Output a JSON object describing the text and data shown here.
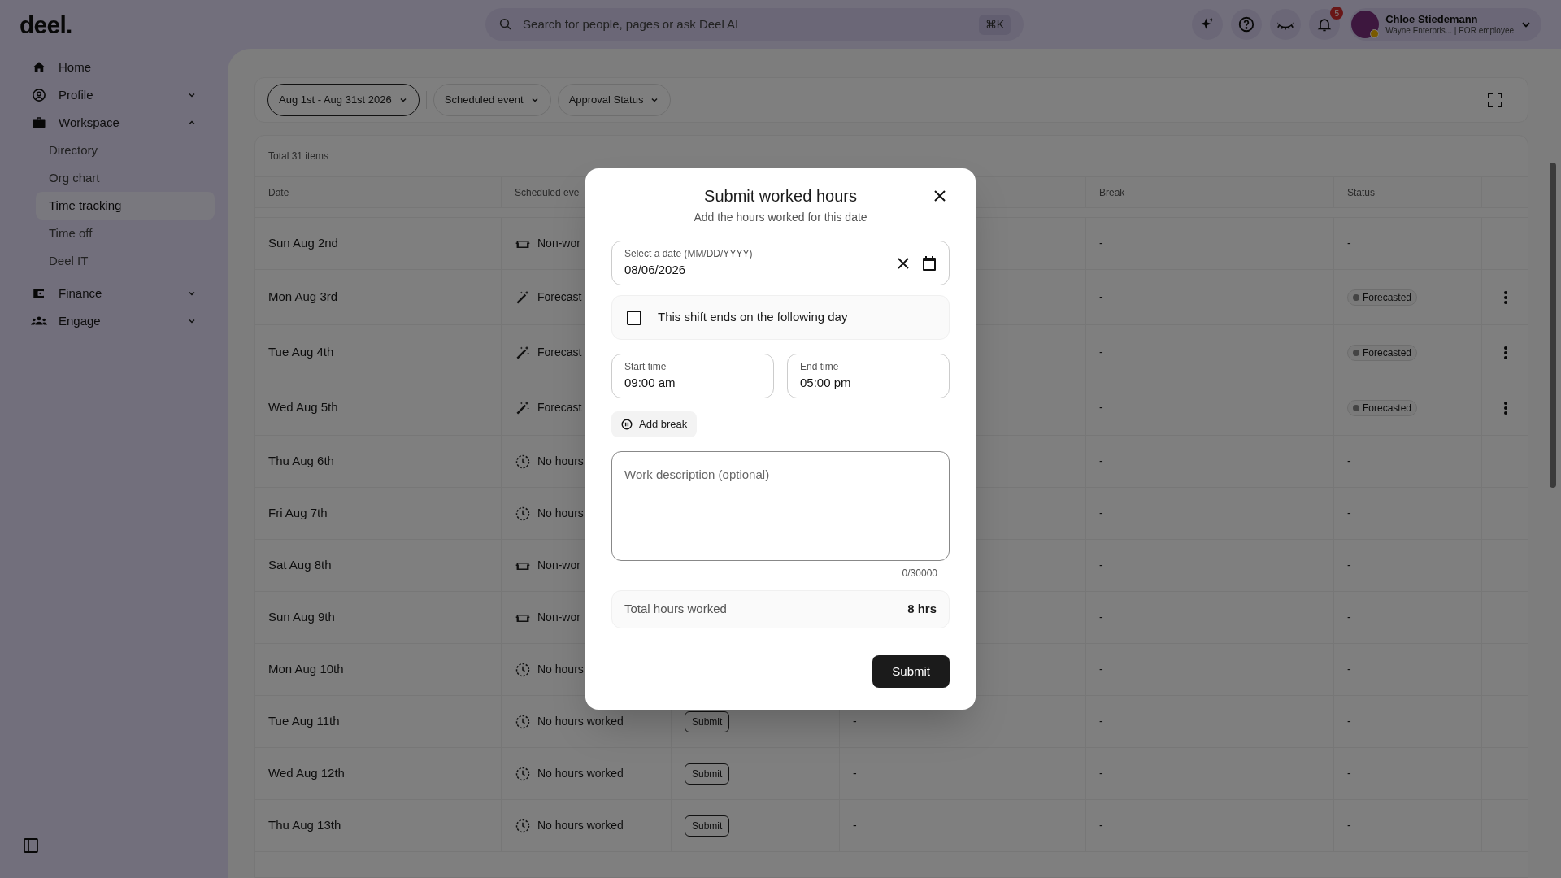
{
  "topbar": {
    "logo": "deel.",
    "search": {
      "placeholder": "Search for people, pages or ask Deel AI",
      "shortcut": "⌘K"
    },
    "notifications": "5",
    "user": {
      "name": "Chloe Stiedemann",
      "subtitle": "Wayne Enterpris... | EOR employee"
    }
  },
  "sidebar": {
    "items": [
      {
        "label": "Home"
      },
      {
        "label": "Profile",
        "expanded": false
      },
      {
        "label": "Workspace",
        "expanded": true,
        "children": [
          {
            "label": "Directory",
            "selected": false
          },
          {
            "label": "Org chart",
            "selected": false
          },
          {
            "label": "Time tracking",
            "selected": true
          },
          {
            "label": "Time off",
            "selected": false
          },
          {
            "label": "Deel IT",
            "selected": false
          }
        ]
      },
      {
        "label": "Finance",
        "expanded": false
      },
      {
        "label": "Engage",
        "expanded": false
      }
    ]
  },
  "filters": [
    {
      "label": "Aug 1st - Aug 31st 2026",
      "selected": true
    },
    {
      "label": "Scheduled event",
      "selected": false
    },
    {
      "label": "Approval Status",
      "selected": false
    }
  ],
  "table": {
    "total": "Total 31 items",
    "columns": [
      "Date",
      "Scheduled eve",
      "Break",
      "Status"
    ],
    "rows": [
      {
        "date": "Sun Aug 2nd",
        "event": {
          "kind": "non_working",
          "text": "Non-wor"
        },
        "break": "-",
        "status": {
          "kind": "dash",
          "text": "-"
        },
        "menu": false
      },
      {
        "date": "Mon Aug 3rd",
        "event": {
          "kind": "forecast",
          "text": "Forecast"
        },
        "break": "-",
        "status": {
          "kind": "badge",
          "text": "Forecasted"
        },
        "menu": true
      },
      {
        "date": "Tue Aug 4th",
        "event": {
          "kind": "forecast",
          "text": "Forecast"
        },
        "break": "-",
        "status": {
          "kind": "badge",
          "text": "Forecasted"
        },
        "menu": true
      },
      {
        "date": "Wed Aug 5th",
        "event": {
          "kind": "forecast",
          "text": "Forecast"
        },
        "break": "-",
        "status": {
          "kind": "badge",
          "text": "Forecasted"
        },
        "menu": true
      },
      {
        "date": "Thu Aug 6th",
        "event": {
          "kind": "no_hours",
          "text": "No hours"
        },
        "break": "-",
        "status": {
          "kind": "dash",
          "text": "-"
        },
        "menu": false
      },
      {
        "date": "Fri Aug 7th",
        "event": {
          "kind": "no_hours",
          "text": "No hours"
        },
        "break": "-",
        "status": {
          "kind": "dash",
          "text": "-"
        },
        "menu": false
      },
      {
        "date": "Sat Aug 8th",
        "event": {
          "kind": "non_working",
          "text": "Non-wor"
        },
        "break": "-",
        "status": {
          "kind": "dash",
          "text": "-"
        },
        "menu": false
      },
      {
        "date": "Sun Aug 9th",
        "event": {
          "kind": "non_working",
          "text": "Non-wor"
        },
        "break": "-",
        "status": {
          "kind": "dash",
          "text": "-"
        },
        "menu": false
      },
      {
        "date": "Mon Aug 10th",
        "event": {
          "kind": "no_hours",
          "text": "No hours"
        },
        "break": "-",
        "status": {
          "kind": "dash",
          "text": "-"
        },
        "menu": false
      },
      {
        "date": "Tue Aug 11th",
        "event": {
          "kind": "no_hours",
          "text": "No hours worked"
        },
        "submit": "Submit",
        "column_4": "-",
        "break": "-",
        "status": {
          "kind": "dash",
          "text": "-"
        },
        "menu": false
      },
      {
        "date": "Wed Aug 12th",
        "event": {
          "kind": "no_hours",
          "text": "No hours worked"
        },
        "submit": "Submit",
        "column_4": "-",
        "break": "-",
        "status": {
          "kind": "dash",
          "text": "-"
        },
        "menu": false
      },
      {
        "date": "Thu Aug 13th",
        "event": {
          "kind": "no_hours",
          "text": "No hours worked"
        },
        "submit": "Submit",
        "column_4": "-",
        "break": "-",
        "status": {
          "kind": "dash",
          "text": "-"
        },
        "menu": false
      }
    ]
  },
  "dialog": {
    "title": "Submit worked hours",
    "subtitle": "Add the hours worked for this date",
    "date_field": {
      "label": "Select a date (MM/DD/YYYY)",
      "value": "08/06/2026"
    },
    "next_day": {
      "label": "This shift ends on the following day",
      "checked": false
    },
    "start_time": {
      "label": "Start time",
      "value": "09:00 am"
    },
    "end_time": {
      "label": "End time",
      "value": "05:00 pm"
    },
    "add_break": "Add break",
    "description": {
      "placeholder": "Work description (optional)",
      "counter": "0/30000"
    },
    "total": {
      "label": "Total hours worked",
      "value": "8 hrs"
    },
    "submit": "Submit"
  }
}
